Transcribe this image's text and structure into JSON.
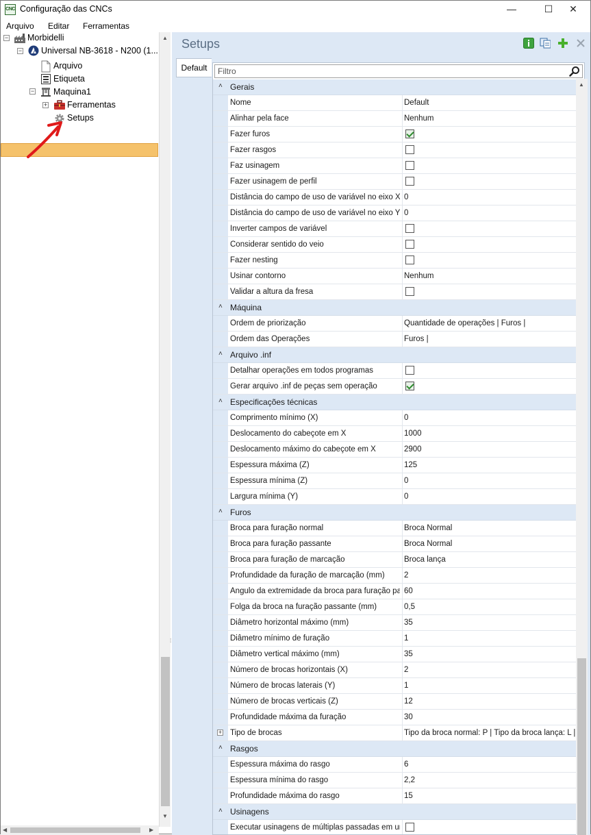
{
  "window": {
    "title": "Configuração das CNCs",
    "icon_label": "CNC",
    "controls": {
      "minimize": "—",
      "maximize": "☐",
      "close": "✕"
    }
  },
  "menu": [
    "Arquivo",
    "Editar",
    "Ferramentas"
  ],
  "tree": {
    "root": "Morbidelli",
    "machine": "Universal NB-3618 - N200 (1...",
    "children": [
      "Arquivo",
      "Etiqueta"
    ],
    "maquina": "Maquina1",
    "ferramentas": "Ferramentas",
    "setups": "Setups"
  },
  "panel": {
    "title": "Setups",
    "tab": "Default",
    "filter_placeholder": "Filtro",
    "toolbar_icons": [
      "info-icon",
      "copy-icon",
      "add-icon",
      "delete-icon"
    ]
  },
  "categories": [
    {
      "name": "Gerais",
      "rows": [
        {
          "label": "Nome",
          "value": "Default"
        },
        {
          "label": "Alinhar pela face",
          "value": "Nenhum"
        },
        {
          "label": "Fazer furos",
          "check": true
        },
        {
          "label": "Fazer rasgos",
          "check": false
        },
        {
          "label": "Faz usinagem",
          "check": false
        },
        {
          "label": "Fazer usinagem de perfil",
          "check": false
        },
        {
          "label": "Distância do campo de uso de variável no eixo X",
          "value": "0"
        },
        {
          "label": "Distância do campo de uso de variável no eixo Y",
          "value": "0"
        },
        {
          "label": "Inverter campos de variável",
          "check": false
        },
        {
          "label": "Considerar sentido do veio",
          "check": false
        },
        {
          "label": "Fazer nesting",
          "check": false
        },
        {
          "label": "Usinar contorno",
          "value": "Nenhum"
        },
        {
          "label": "Validar a altura da fresa",
          "check": false
        }
      ]
    },
    {
      "name": "Máquina",
      "rows": [
        {
          "label": "Ordem de priorização",
          "value": "Quantidade de operações | Furos |"
        },
        {
          "label": "Ordem das Operações",
          "value": "Furos |"
        }
      ]
    },
    {
      "name": "Arquivo .inf",
      "rows": [
        {
          "label": "Detalhar operações em todos programas",
          "check": false
        },
        {
          "label": "Gerar arquivo .inf de peças sem operação",
          "check": true
        }
      ]
    },
    {
      "name": "Especificações técnicas",
      "rows": [
        {
          "label": "Comprimento mínimo (X)",
          "value": "0"
        },
        {
          "label": "Deslocamento do cabeçote em X",
          "value": "1000"
        },
        {
          "label": "Deslocamento máximo do cabeçote em X",
          "value": "2900"
        },
        {
          "label": "Espessura máxima (Z)",
          "value": "125"
        },
        {
          "label": "Espessura mínima (Z)",
          "value": "0"
        },
        {
          "label": "Largura mínima (Y)",
          "value": "0"
        }
      ]
    },
    {
      "name": "Furos",
      "rows": [
        {
          "label": "Broca para furação normal",
          "value": "Broca Normal"
        },
        {
          "label": "Broca para furação passante",
          "value": "Broca Normal"
        },
        {
          "label": "Broca para furação de marcação",
          "value": "Broca lança"
        },
        {
          "label": "Profundidade da furação de marcação (mm)",
          "value": "2"
        },
        {
          "label": "Ângulo da extremidade da broca para furação pa",
          "value": "60"
        },
        {
          "label": "Folga da broca na furação passante (mm)",
          "value": "0,5"
        },
        {
          "label": "Diâmetro horizontal máximo (mm)",
          "value": "35"
        },
        {
          "label": "Diâmetro mínimo de furação",
          "value": "1"
        },
        {
          "label": "Diâmetro vertical máximo (mm)",
          "value": "35"
        },
        {
          "label": "Número de brocas horizontais (X)",
          "value": "2"
        },
        {
          "label": "Número de brocas laterais (Y)",
          "value": "1"
        },
        {
          "label": "Número de brocas verticais (Z)",
          "value": "12"
        },
        {
          "label": "Profundidade máxima da furação",
          "value": "30"
        },
        {
          "label": "Tipo de brocas",
          "value": "Tipo da broca normal: P  |  Tipo da broca lança: L  |",
          "expandable": true
        }
      ]
    },
    {
      "name": "Rasgos",
      "rows": [
        {
          "label": "Espessura máxima do rasgo",
          "value": "6"
        },
        {
          "label": "Espessura mínima do rasgo",
          "value": "2,2"
        },
        {
          "label": "Profundidade máxima do rasgo",
          "value": "15"
        }
      ]
    },
    {
      "name": "Usinagens",
      "rows": [
        {
          "label": "Executar usinagens de múltiplas passadas em um",
          "check": false
        }
      ]
    }
  ],
  "colors": {
    "selection": "#f5c26b",
    "panel_bg": "#dde8f5",
    "title": "#5b6e84",
    "check": "#2e8b2e"
  }
}
